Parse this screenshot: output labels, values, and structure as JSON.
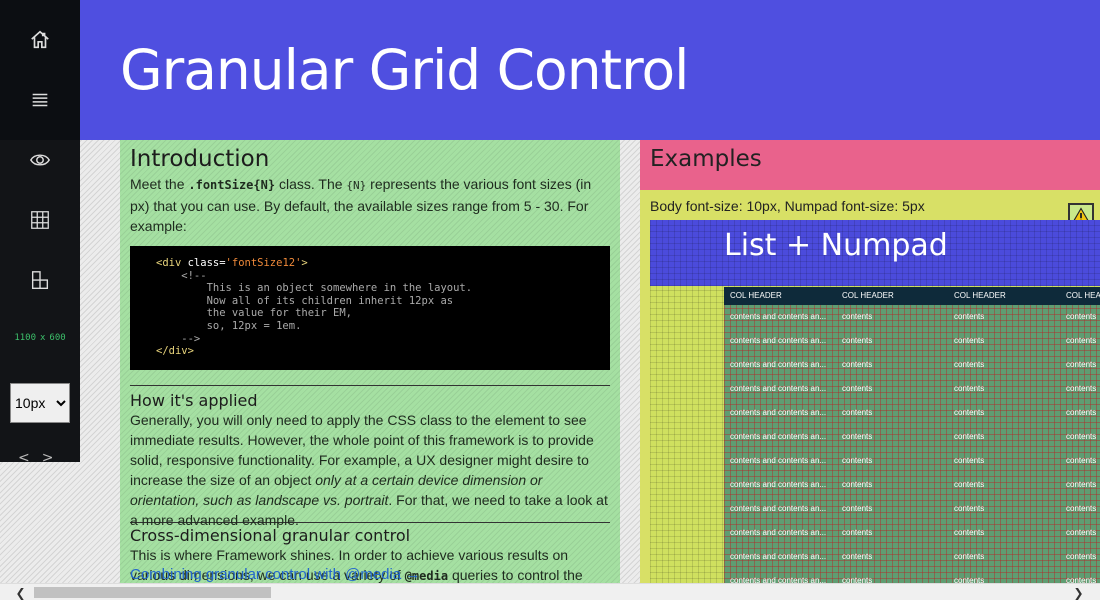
{
  "sidebar": {
    "nav": [
      {
        "icon": "home-icon"
      },
      {
        "icon": "menu-icon"
      },
      {
        "icon": "eye-icon"
      },
      {
        "icon": "grid-icon"
      },
      {
        "icon": "layout-icon"
      }
    ],
    "viewport": {
      "width": "1100",
      "sep": "x",
      "height": "600"
    },
    "font_size_select": {
      "value": "10px",
      "options": [
        "10px"
      ]
    },
    "prev": "<",
    "next": ">"
  },
  "header": {
    "title": "Granular Grid Control"
  },
  "intro": {
    "title": "Introduction",
    "p1_a": "Meet the ",
    "p1_code": ".fontSize{N}",
    "p1_b": " class. The ",
    "p1_code2": "{N}",
    "p1_c": " represents the various font sizes (in px) that you can use. By default, the available sizes range from 5 - 30. For example:",
    "code_lines": {
      "l1_open": "<div ",
      "l1_attr": "class=",
      "l1_str": "'fontSize12'",
      "l1_close": ">",
      "l2": "    <!--",
      "l3": "        This is an object somewhere in the layout.",
      "l4": "        Now all of its children inherit 12px as",
      "l5": "        the value for their EM,",
      "l6": "        so, 12px = 1em.",
      "l7": "    -->",
      "l8": "</div>"
    },
    "h2": "How it's applied",
    "p2_a": "Generally, you will only need to apply the CSS class to the element to see immediate results. However, the whole point of this framework is to provide solid, responsive functionality. For example, a UX designer might desire to increase the size of an object ",
    "p2_em": "only at a certain device dimension or orientation, such as landscape vs. portrait",
    "p2_b": ". For that, we need to take a look at a more advanced example.",
    "h3": "Cross-dimensional granular control",
    "p3_a": "This is where Framework shines. In order to achieve various results on various dimensions, we can use a variety of ",
    "p3_code": "@media",
    "p3_b": " queries to control the sizes of individual objects across the app.",
    "link": "Combining granular control with @media →"
  },
  "examples": {
    "title": "Examples",
    "label": "Body font-size: 10px, Numpad font-size: 5px",
    "panel_title": "List + Numpad",
    "table": {
      "headers": [
        "COL HEADER",
        "COL HEADER",
        "COL HEADER",
        "COL HEADER"
      ],
      "rows": [
        [
          "contents and contents an...",
          "contents",
          "contents",
          "contents"
        ],
        [
          "contents and contents an...",
          "contents",
          "contents",
          "contents"
        ],
        [
          "contents and contents an...",
          "contents",
          "contents",
          "contents"
        ],
        [
          "contents and contents an...",
          "contents",
          "contents",
          "contents"
        ],
        [
          "contents and contents an...",
          "contents",
          "contents",
          "contents"
        ],
        [
          "contents and contents an...",
          "contents",
          "contents",
          "contents"
        ],
        [
          "contents and contents an...",
          "contents",
          "contents",
          "contents"
        ],
        [
          "contents and contents an...",
          "contents",
          "contents",
          "contents"
        ],
        [
          "contents and contents an...",
          "contents",
          "contents",
          "contents"
        ],
        [
          "contents and contents an...",
          "contents",
          "contents",
          "contents"
        ],
        [
          "contents and contents an...",
          "contents",
          "contents",
          "contents"
        ],
        [
          "contents and contents an...",
          "contents",
          "contents",
          "contents"
        ]
      ]
    }
  },
  "scrollbar": {
    "left": "❮",
    "right": "❯"
  }
}
